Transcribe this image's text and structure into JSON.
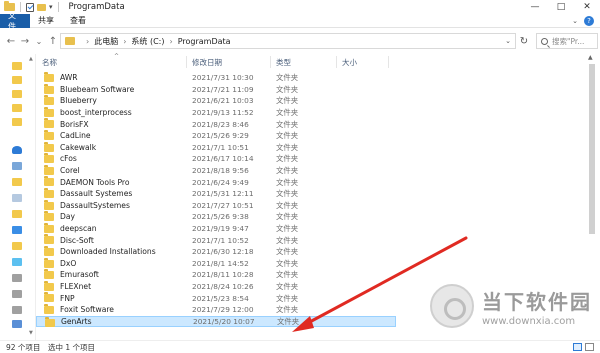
{
  "window": {
    "title": "ProgramData",
    "controls": {
      "minimize": "—",
      "maximize": "□",
      "close": "✕"
    }
  },
  "ribbon": {
    "tabs": [
      "文件",
      "共享",
      "查看"
    ],
    "help": "?"
  },
  "nav": {
    "back": "←",
    "forward": "→",
    "recent": "⌄",
    "up": "↑"
  },
  "address": {
    "crumbs": [
      "此电脑",
      "系统 (C:)",
      "ProgramData"
    ],
    "separator": "›"
  },
  "search": {
    "placeholder": "搜索\"Pr...",
    "icon": "search-icon"
  },
  "columns": {
    "name": "名称",
    "date": "修改日期",
    "type": "类型",
    "size": "大小"
  },
  "files": [
    {
      "name": "AWR",
      "date": "2021/7/31 10:30",
      "type": "文件夹"
    },
    {
      "name": "Bluebeam Software",
      "date": "2021/7/21 11:09",
      "type": "文件夹"
    },
    {
      "name": "Blueberry",
      "date": "2021/6/21 10:03",
      "type": "文件夹"
    },
    {
      "name": "boost_interprocess",
      "date": "2021/9/13 11:52",
      "type": "文件夹"
    },
    {
      "name": "BorisFX",
      "date": "2021/8/23 8:46",
      "type": "文件夹"
    },
    {
      "name": "CadLine",
      "date": "2021/5/26 9:29",
      "type": "文件夹"
    },
    {
      "name": "Cakewalk",
      "date": "2021/7/1 10:51",
      "type": "文件夹"
    },
    {
      "name": "cFos",
      "date": "2021/6/17 10:14",
      "type": "文件夹"
    },
    {
      "name": "Corel",
      "date": "2021/8/18 9:56",
      "type": "文件夹"
    },
    {
      "name": "DAEMON Tools Pro",
      "date": "2021/6/24 9:49",
      "type": "文件夹"
    },
    {
      "name": "Dassault Systemes",
      "date": "2021/5/31 12:11",
      "type": "文件夹"
    },
    {
      "name": "DassaultSystemes",
      "date": "2021/7/27 10:51",
      "type": "文件夹"
    },
    {
      "name": "Day",
      "date": "2021/5/26 9:38",
      "type": "文件夹"
    },
    {
      "name": "deepscan",
      "date": "2021/9/19 9:47",
      "type": "文件夹"
    },
    {
      "name": "Disc-Soft",
      "date": "2021/7/1 10:52",
      "type": "文件夹"
    },
    {
      "name": "Downloaded Installations",
      "date": "2021/6/30 12:18",
      "type": "文件夹"
    },
    {
      "name": "DxO",
      "date": "2021/8/1 14:52",
      "type": "文件夹"
    },
    {
      "name": "Emurasoft",
      "date": "2021/8/11 10:28",
      "type": "文件夹"
    },
    {
      "name": "FLEXnet",
      "date": "2021/8/24 10:26",
      "type": "文件夹"
    },
    {
      "name": "FNP",
      "date": "2021/5/23 8:54",
      "type": "文件夹"
    },
    {
      "name": "Foxit Software",
      "date": "2021/7/29 12:00",
      "type": "文件夹"
    },
    {
      "name": "GenArts",
      "date": "2021/5/20 10:07",
      "type": "文件夹",
      "selected": true
    }
  ],
  "status": {
    "count": "92 个项目",
    "selected": "选中 1 个项目"
  },
  "colors": {
    "accent": "#1a5ea8",
    "selection": "#cce8ff",
    "folder": "#f2c94c",
    "arrow": "#e02a22"
  },
  "watermark": {
    "title": "当下软件园",
    "url": "www.downxia.com"
  }
}
